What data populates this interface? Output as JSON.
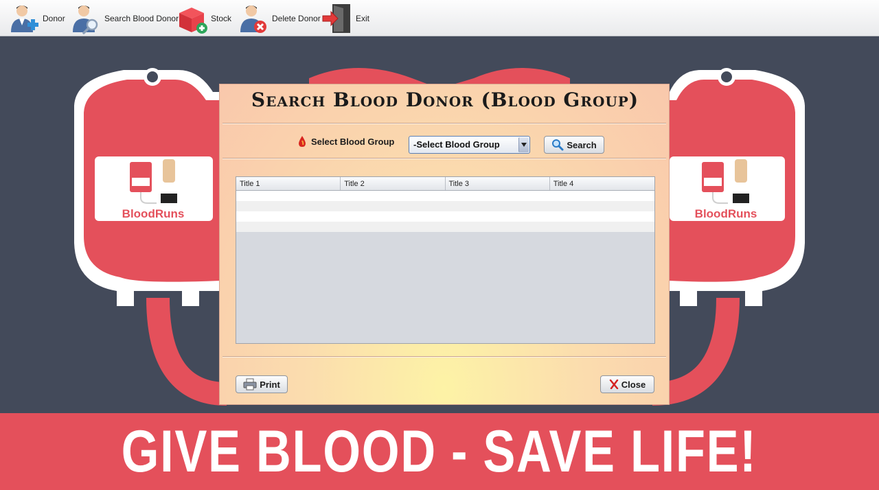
{
  "toolbar": {
    "items": [
      {
        "label": "Donor",
        "icon": "add-donor-icon"
      },
      {
        "label": "Search Blood Donor",
        "icon": "search-donor-icon"
      },
      {
        "label": "Stock",
        "icon": "stock-box-icon"
      },
      {
        "label": "Delete Donor",
        "icon": "delete-donor-icon"
      },
      {
        "label": "Exit",
        "icon": "exit-door-icon"
      }
    ]
  },
  "background": {
    "logo_text_left": "BloodRuns",
    "logo_text_right": "BloodRuns",
    "banner": "GIVE BLOOD - SAVE LIFE!",
    "colors": {
      "backdrop": "#434a5a",
      "blood": "#e4505b"
    }
  },
  "dialog": {
    "title": "Search Blood Donor (Blood Group)",
    "select_label": "Select Blood Group",
    "combo_value": "-Select Blood Group",
    "search_button": "Search",
    "print_button": "Print",
    "close_button": "Close",
    "table": {
      "columns": [
        "Title 1",
        "Title 2",
        "Title 3",
        "Title 4"
      ],
      "rows": [
        [
          "",
          "",
          "",
          ""
        ],
        [
          "",
          "",
          "",
          ""
        ],
        [
          "",
          "",
          "",
          ""
        ],
        [
          "",
          "",
          "",
          ""
        ]
      ]
    }
  }
}
